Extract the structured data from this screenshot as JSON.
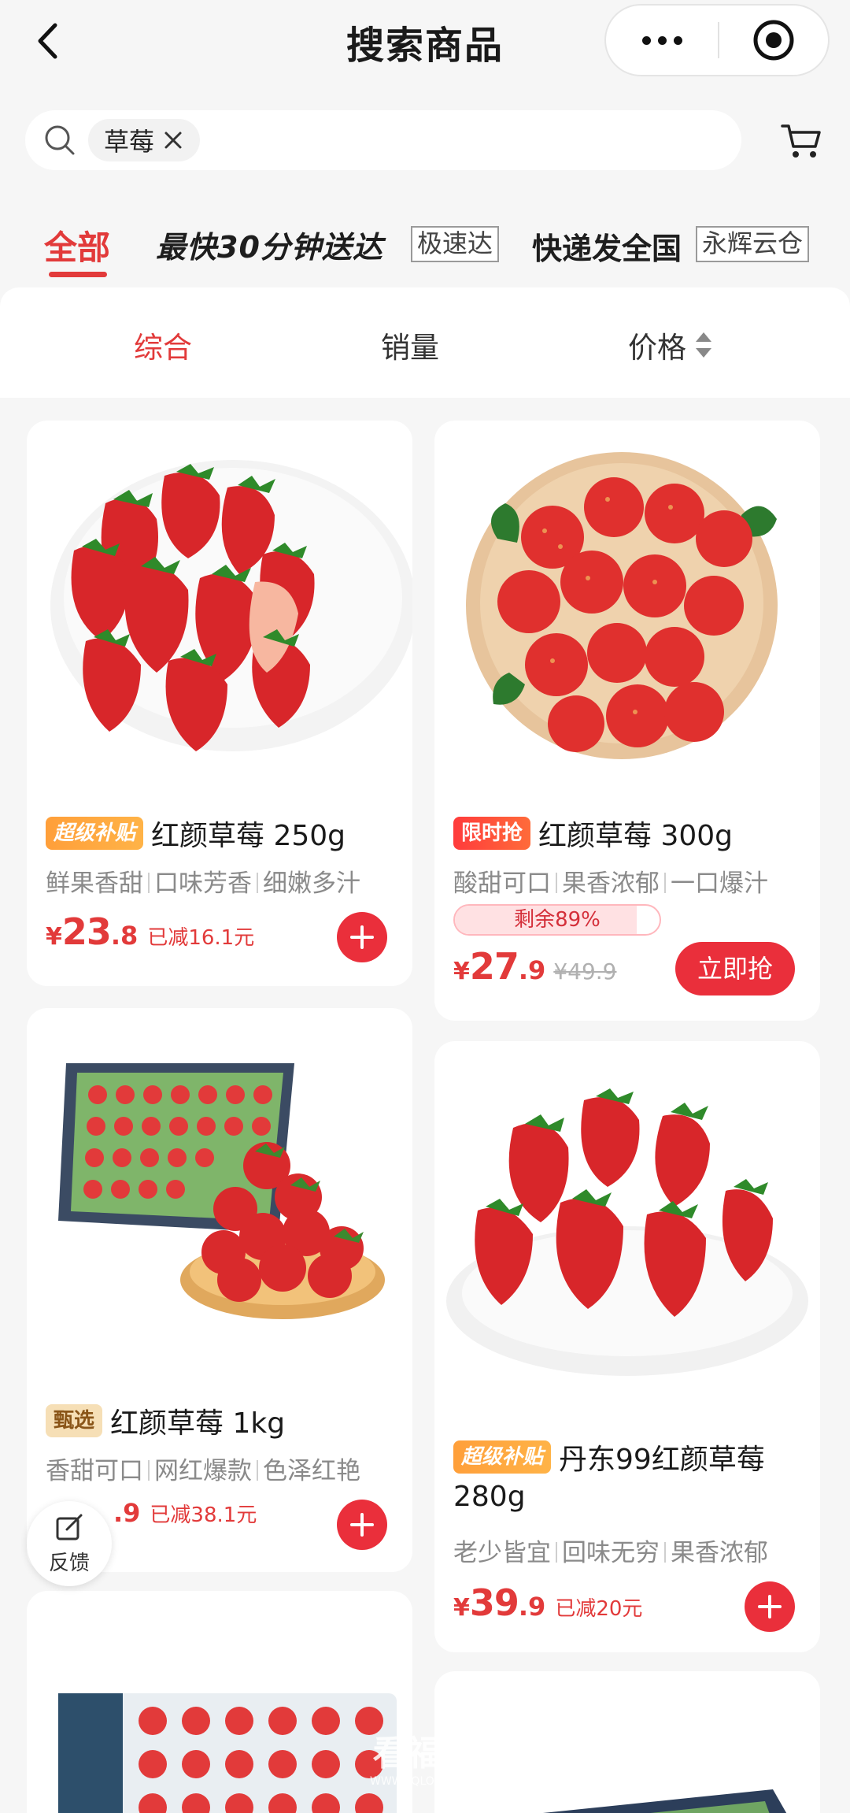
{
  "header": {
    "title": "搜索商品"
  },
  "search": {
    "keyword": "草莓"
  },
  "channels": {
    "all": "全部",
    "fast": "最快30分钟送达",
    "fast_tag": "极速达",
    "nationwide": "快递发全国",
    "nationwide_tag": "永辉云仓"
  },
  "sort": {
    "comprehensive": "综合",
    "sales": "销量",
    "price": "价格"
  },
  "products": [
    {
      "badge": "超级补贴",
      "title": "红颜草莓 250g",
      "features": [
        "鲜果香甜",
        "口味芳香",
        "细嫩多汁"
      ],
      "price_int": "23",
      "price_dec": ".8",
      "saved": "已减16.1元",
      "currency": "¥"
    },
    {
      "badge": "限时抢",
      "title": "红颜草莓 300g",
      "features": [
        "酸甜可口",
        "果香浓郁",
        "一口爆汁"
      ],
      "stock_text": "剩余89%",
      "stock_percent": 89,
      "price_int": "27",
      "price_dec": ".9",
      "original_price": "¥49.9",
      "buy_label": "立即抢",
      "currency": "¥"
    },
    {
      "badge": "甄选",
      "title": "红颜草莓 1kg",
      "features": [
        "香甜可口",
        "网红爆款",
        "色泽红艳"
      ],
      "price_dec": ".9",
      "saved": "已减38.1元"
    },
    {
      "badge": "超级补贴",
      "title_line1": "丹东99红颜草莓",
      "title_line2": "280g",
      "features": [
        "老少皆宜",
        "回味无穷",
        "果香浓郁"
      ],
      "price_int": "39",
      "price_dec": ".9",
      "saved": "已减20元",
      "currency": "¥"
    }
  ],
  "feedback": {
    "label": "反馈"
  },
  "watermark": {
    "line1": "看福清",
    "line2": "WWW.FQLOOK.COM"
  },
  "colors": {
    "accent": "#e23a3a",
    "background": "#f6f6f6",
    "card": "#ffffff"
  }
}
